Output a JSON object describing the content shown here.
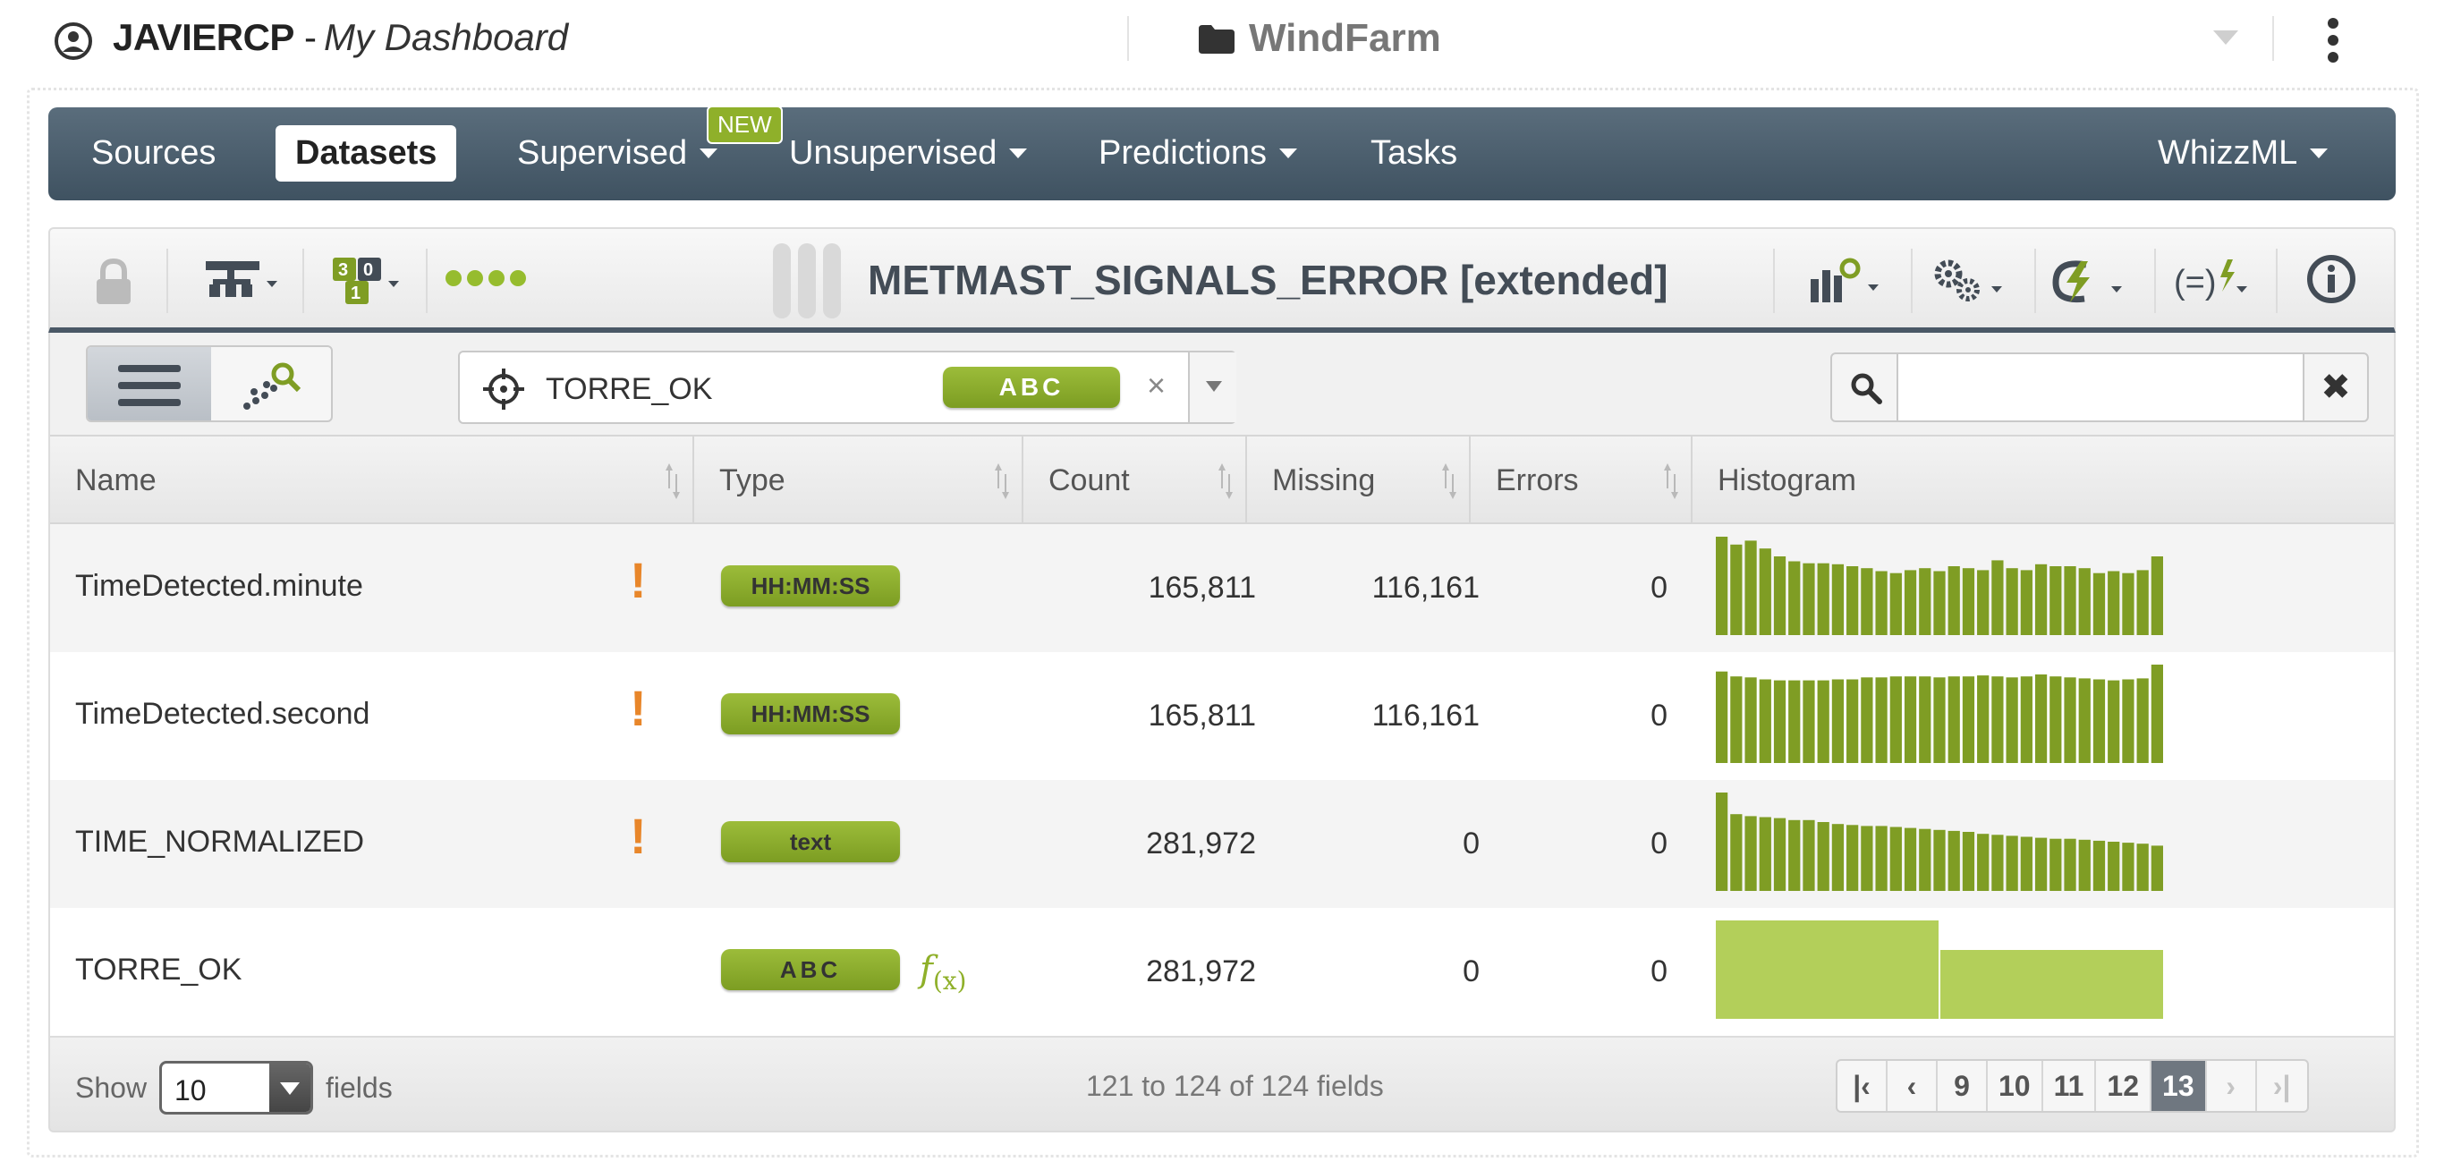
{
  "header": {
    "user": "JAVIERCP",
    "separator": " - ",
    "dashboard": "My Dashboard",
    "project": "WindFarm"
  },
  "nav": {
    "sources": "Sources",
    "datasets": "Datasets",
    "supervised": "Supervised",
    "new_badge": "NEW",
    "unsupervised": "Unsupervised",
    "predictions": "Predictions",
    "tasks": "Tasks",
    "whizzml": "WhizzML"
  },
  "dataset": {
    "title": "METMAST_SIGNALS_ERROR [extended]"
  },
  "objective": {
    "field": "TORRE_OK",
    "type": "ABC",
    "clear": "×"
  },
  "search": {
    "value": "",
    "clear": "✖"
  },
  "table": {
    "headers": [
      "Name",
      "Type",
      "Count",
      "Missing",
      "Errors",
      "Histogram"
    ],
    "rows": [
      {
        "name": "TimeDetected.minute",
        "warning": "!",
        "type": "HH:MM:SS",
        "count": "165,811",
        "missing": "116,161",
        "errors": "0"
      },
      {
        "name": "TimeDetected.second",
        "warning": "!",
        "type": "HH:MM:SS",
        "count": "165,811",
        "missing": "116,161",
        "errors": "0"
      },
      {
        "name": "TIME_NORMALIZED",
        "warning": "!",
        "type": "text",
        "count": "281,972",
        "missing": "0",
        "errors": "0"
      },
      {
        "name": "TORRE_OK",
        "warning": "",
        "type": "ABC",
        "fx": "f",
        "fx_sub": "(x)",
        "count": "281,972",
        "missing": "0",
        "errors": "0"
      }
    ]
  },
  "histograms": [
    {
      "color": "#7f9d24",
      "values": [
        100,
        92,
        96,
        88,
        80,
        75,
        73,
        73,
        72,
        70,
        68,
        65,
        63,
        66,
        68,
        65,
        70,
        68,
        66,
        76,
        68,
        66,
        72,
        70,
        70,
        68,
        63,
        65,
        63,
        66,
        80
      ]
    },
    {
      "color": "#7f9d24",
      "values": [
        93,
        88,
        87,
        85,
        84,
        84,
        84,
        84,
        85,
        85,
        87,
        87,
        88,
        88,
        88,
        87,
        88,
        88,
        89,
        88,
        87,
        88,
        90,
        88,
        87,
        86,
        85,
        84,
        85,
        86,
        100
      ]
    },
    {
      "color": "#7f9d24",
      "values": [
        100,
        78,
        76,
        75,
        74,
        72,
        72,
        70,
        68,
        67,
        66,
        66,
        65,
        64,
        63,
        62,
        61,
        60,
        58,
        57,
        56,
        55,
        54,
        53,
        53,
        52,
        51,
        50,
        49,
        48,
        46
      ]
    },
    {
      "color": "#b3cf5a",
      "values": [
        100,
        70
      ]
    }
  ],
  "footer": {
    "show": "Show",
    "page_size": "10",
    "fields": "fields",
    "range": "121 to 124 of 124 fields",
    "pages": [
      "9",
      "10",
      "11",
      "12",
      "13"
    ],
    "current_page": "13"
  },
  "colors": {
    "accent": "#8fb02a",
    "nav": "#4a5b69",
    "warning": "#e8862a"
  }
}
